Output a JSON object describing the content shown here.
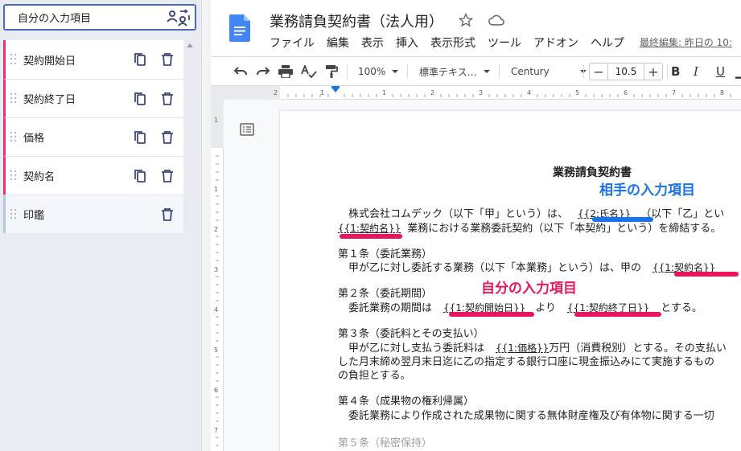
{
  "panel": {
    "header_label": "自分の入力項目",
    "items": [
      {
        "label": "契約開始日"
      },
      {
        "label": "契約終了日"
      },
      {
        "label": "価格"
      },
      {
        "label": "契約名"
      },
      {
        "label": "印鑑"
      }
    ]
  },
  "docs": {
    "title": "業務請負契約書（法人用）",
    "menu": [
      "ファイル",
      "編集",
      "表示",
      "挿入",
      "表示形式",
      "ツール",
      "アドオン",
      "ヘルプ"
    ],
    "last_edit": "最終編集: 昨日の 10:",
    "toolbar": {
      "zoom": "100%",
      "style": "標準テキス…",
      "font": "Century",
      "font_size": "10.5",
      "minus": "−",
      "plus": "+"
    }
  },
  "document": {
    "heading": "業務請負契約書",
    "p1a_pre": "株式会社コムデック（以下「甲」という）は、",
    "p1a_ph": "{{2:氏名}}",
    "p1a_post": "（以下「乙」とい",
    "p1b_ph": "{{1:契約名}}",
    "p1b_post": "業務における業務委託契約（以下「本契約」という）を締結する。",
    "a1_title": "第１条（委託業務）",
    "a1_pre": "甲が乙に対し委託する業務（以下「本業務」という）は、甲の",
    "a1_ph": "{{1:契約名}}",
    "a2_title": "第２条（委託期間）",
    "a2_pre": "委託業務の期間は",
    "a2_ph1": "{{1:契約開始日}}",
    "a2_mid": "より",
    "a2_ph2": "{{1:契約終了日}}",
    "a2_post": "とする。",
    "a3_title": "第３条（委託料とその支払い）",
    "a3_pre": "甲が乙に対し支払う委託料は",
    "a3_ph": "{{1:価格}}",
    "a3_post": "万円（消費税別）とする。その支払い",
    "a3_l2": "した月末締め翌月末日迄に乙の指定する銀行口座に現金振込みにて実施するもの",
    "a3_l3": "の負担とする。",
    "a4_title": "第４条（成果物の権利帰属）",
    "a4_l1": "委託業務により作成された成果物に関する無体財産権及び有体物に関する一切",
    "a5_partial": "第５条（秘密保持）"
  },
  "annotations": {
    "other_label": "相手の入力項目",
    "self_label": "自分の入力項目",
    "other_color": "#1a73e8",
    "self_color": "#e8175d"
  }
}
